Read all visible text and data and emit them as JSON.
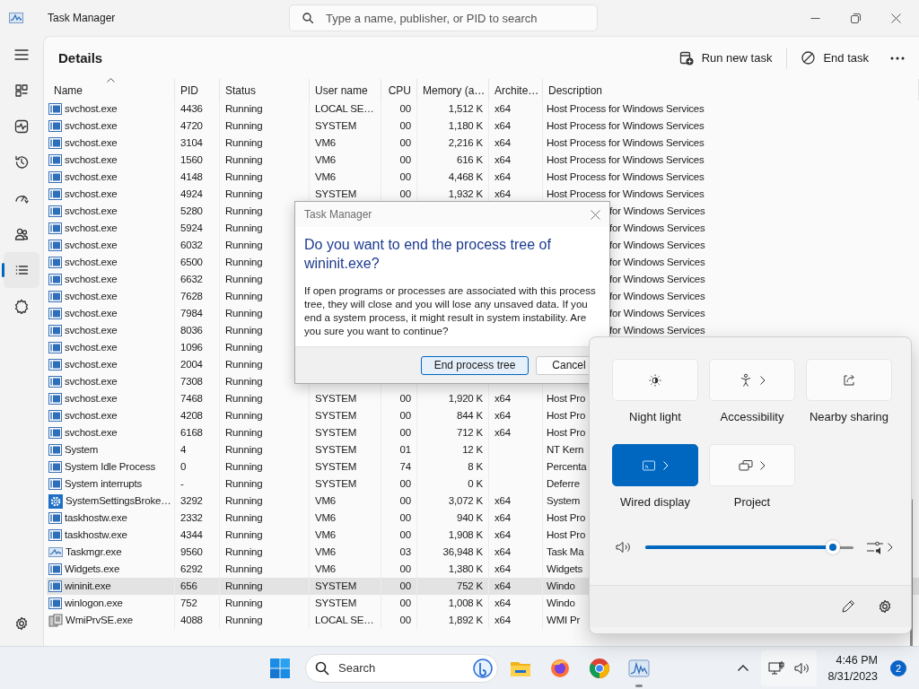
{
  "window": {
    "title": "Task Manager"
  },
  "search": {
    "placeholder": "Type a name, publisher, or PID to search"
  },
  "nav": [
    {
      "kind": "menu",
      "selected": false
    },
    {
      "kind": "processes",
      "selected": false
    },
    {
      "kind": "performance",
      "selected": false
    },
    {
      "kind": "history",
      "selected": false
    },
    {
      "kind": "startup",
      "selected": false
    },
    {
      "kind": "users",
      "selected": false
    },
    {
      "kind": "details",
      "selected": true
    },
    {
      "kind": "services",
      "selected": false
    },
    {
      "kind": "settings",
      "selected": false
    }
  ],
  "page": {
    "title": "Details",
    "actions": [
      {
        "kind": "run",
        "label": "Run new task"
      },
      {
        "kind": "end",
        "label": "End task"
      },
      {
        "kind": "more"
      }
    ]
  },
  "table": {
    "columns": [
      {
        "label": "Name",
        "sorted": true
      },
      {
        "label": "PID",
        "sorted": false
      },
      {
        "label": "Status",
        "sorted": false
      },
      {
        "label": "User name",
        "sorted": false
      },
      {
        "label": "CPU",
        "sorted": false
      },
      {
        "label": "Memory (a…",
        "sorted": false
      },
      {
        "label": "Archite…",
        "sorted": false
      },
      {
        "label": "Description",
        "sorted": false
      }
    ],
    "rows": [
      {
        "kind": "app",
        "name": "svchost.exe",
        "pid": "4436",
        "status": "Running",
        "user": "LOCAL SE…",
        "cpu": "00",
        "memory": "1,512 K",
        "arch": "x64",
        "description": "Host Process for Windows Services",
        "selected": false
      },
      {
        "kind": "app",
        "name": "svchost.exe",
        "pid": "4720",
        "status": "Running",
        "user": "SYSTEM",
        "cpu": "00",
        "memory": "1,180 K",
        "arch": "x64",
        "description": "Host Process for Windows Services",
        "selected": false
      },
      {
        "kind": "app",
        "name": "svchost.exe",
        "pid": "3104",
        "status": "Running",
        "user": "VM6",
        "cpu": "00",
        "memory": "2,216 K",
        "arch": "x64",
        "description": "Host Process for Windows Services",
        "selected": false
      },
      {
        "kind": "app",
        "name": "svchost.exe",
        "pid": "1560",
        "status": "Running",
        "user": "VM6",
        "cpu": "00",
        "memory": "616 K",
        "arch": "x64",
        "description": "Host Process for Windows Services",
        "selected": false
      },
      {
        "kind": "app",
        "name": "svchost.exe",
        "pid": "4148",
        "status": "Running",
        "user": "VM6",
        "cpu": "00",
        "memory": "4,468 K",
        "arch": "x64",
        "description": "Host Process for Windows Services",
        "selected": false
      },
      {
        "kind": "app",
        "name": "svchost.exe",
        "pid": "4924",
        "status": "Running",
        "user": "SYSTEM",
        "cpu": "00",
        "memory": "1,932 K",
        "arch": "x64",
        "description": "Host Process for Windows Services",
        "selected": false
      },
      {
        "kind": "app",
        "name": "svchost.exe",
        "pid": "5280",
        "status": "Running",
        "description": "for Windows Services",
        "selected": false
      },
      {
        "kind": "app",
        "name": "svchost.exe",
        "pid": "5924",
        "status": "Running",
        "description": "for Windows Services",
        "selected": false
      },
      {
        "kind": "app",
        "name": "svchost.exe",
        "pid": "6032",
        "status": "Running",
        "description": "for Windows Services",
        "selected": false
      },
      {
        "kind": "app",
        "name": "svchost.exe",
        "pid": "6500",
        "status": "Running",
        "description": "for Windows Services",
        "selected": false
      },
      {
        "kind": "app",
        "name": "svchost.exe",
        "pid": "6632",
        "status": "Running",
        "description": "for Windows Services",
        "selected": false
      },
      {
        "kind": "app",
        "name": "svchost.exe",
        "pid": "7628",
        "status": "Running",
        "description": "for Windows Services",
        "selected": false
      },
      {
        "kind": "app",
        "name": "svchost.exe",
        "pid": "7984",
        "status": "Running",
        "description": "for Windows Services",
        "selected": false
      },
      {
        "kind": "app",
        "name": "svchost.exe",
        "pid": "8036",
        "status": "Running",
        "description": "for Windows Services",
        "selected": false
      },
      {
        "kind": "app",
        "name": "svchost.exe",
        "pid": "1096",
        "status": "Running",
        "selected": false
      },
      {
        "kind": "app",
        "name": "svchost.exe",
        "pid": "2004",
        "status": "Running",
        "selected": false
      },
      {
        "kind": "app",
        "name": "svchost.exe",
        "pid": "7308",
        "status": "Running",
        "selected": false
      },
      {
        "kind": "app",
        "name": "svchost.exe",
        "pid": "7468",
        "status": "Running",
        "user": "SYSTEM",
        "cpu": "00",
        "memory": "1,920 K",
        "arch": "x64",
        "description": "Host Pro",
        "selected": false
      },
      {
        "kind": "app",
        "name": "svchost.exe",
        "pid": "4208",
        "status": "Running",
        "user": "SYSTEM",
        "cpu": "00",
        "memory": "844 K",
        "arch": "x64",
        "description": "Host Pro",
        "selected": false
      },
      {
        "kind": "app",
        "name": "svchost.exe",
        "pid": "6168",
        "status": "Running",
        "user": "SYSTEM",
        "cpu": "00",
        "memory": "712 K",
        "arch": "x64",
        "description": "Host Pro",
        "selected": false
      },
      {
        "kind": "app",
        "name": "System",
        "pid": "4",
        "status": "Running",
        "user": "SYSTEM",
        "cpu": "01",
        "memory": "12 K",
        "description": "NT Kern",
        "selected": false
      },
      {
        "kind": "app",
        "name": "System Idle Process",
        "pid": "0",
        "status": "Running",
        "user": "SYSTEM",
        "cpu": "74",
        "memory": "8 K",
        "description": "Percenta",
        "selected": false
      },
      {
        "kind": "app",
        "name": "System interrupts",
        "pid": "-",
        "status": "Running",
        "user": "SYSTEM",
        "cpu": "00",
        "memory": "0 K",
        "description": "Deferre",
        "selected": false
      },
      {
        "kind": "gear",
        "name": "SystemSettingsBroke…",
        "pid": "3292",
        "status": "Running",
        "user": "VM6",
        "cpu": "00",
        "memory": "3,072 K",
        "arch": "x64",
        "description": "System",
        "selected": false
      },
      {
        "kind": "app",
        "name": "taskhostw.exe",
        "pid": "2332",
        "status": "Running",
        "user": "VM6",
        "cpu": "00",
        "memory": "940 K",
        "arch": "x64",
        "description": "Host Pro",
        "selected": false
      },
      {
        "kind": "app",
        "name": "taskhostw.exe",
        "pid": "4344",
        "status": "Running",
        "user": "VM6",
        "cpu": "00",
        "memory": "1,908 K",
        "arch": "x64",
        "description": "Host Pro",
        "selected": false
      },
      {
        "kind": "chart",
        "name": "Taskmgr.exe",
        "pid": "9560",
        "status": "Running",
        "user": "VM6",
        "cpu": "03",
        "memory": "36,948 K",
        "arch": "x64",
        "description": "Task Ma",
        "selected": false
      },
      {
        "kind": "app",
        "name": "Widgets.exe",
        "pid": "6292",
        "status": "Running",
        "user": "VM6",
        "cpu": "00",
        "memory": "1,380 K",
        "arch": "x64",
        "description": "Widgets",
        "selected": false
      },
      {
        "kind": "app",
        "name": "wininit.exe",
        "pid": "656",
        "status": "Running",
        "user": "SYSTEM",
        "cpu": "00",
        "memory": "752 K",
        "arch": "x64",
        "description": "Windo",
        "selected": true
      },
      {
        "kind": "app",
        "name": "winlogon.exe",
        "pid": "752",
        "status": "Running",
        "user": "SYSTEM",
        "cpu": "00",
        "memory": "1,008 K",
        "arch": "x64",
        "description": "Windo",
        "selected": false
      },
      {
        "kind": "wmi",
        "name": "WmiPrvSE.exe",
        "pid": "4088",
        "status": "Running",
        "user": "LOCAL SE…",
        "cpu": "00",
        "memory": "1,892 K",
        "arch": "x64",
        "description": "WMI Pr",
        "selected": false
      }
    ]
  },
  "dialog": {
    "title": "Task Manager",
    "heading": "Do you want to end the process tree of wininit.exe?",
    "message": "If open programs or processes are associated with this process tree, they will close and you will lose any unsaved data. If you end a system process, it might result in system instability. Are you sure you want to continue?",
    "buttons": [
      {
        "label": "End process tree",
        "default": true
      },
      {
        "label": "Cancel",
        "default": false
      }
    ]
  },
  "quick_settings": {
    "tiles": [
      {
        "kind": "nightlight",
        "label": "Night light",
        "on": false,
        "chevron": false
      },
      {
        "kind": "accessibility",
        "label": "Accessibility",
        "on": false,
        "chevron": true
      },
      {
        "kind": "share",
        "label": "Nearby sharing",
        "on": false,
        "chevron": false
      },
      {
        "kind": "cast",
        "label": "Wired display",
        "on": true,
        "chevron": true
      },
      {
        "kind": "project",
        "label": "Project",
        "on": false,
        "chevron": true
      }
    ],
    "volume": {
      "level": 0.9
    }
  },
  "taskbar": {
    "search": {
      "placeholder": "Search"
    },
    "apps": [
      {
        "kind": "explorer",
        "active": false
      },
      {
        "kind": "firefox",
        "active": false
      },
      {
        "kind": "chrome",
        "active": false
      },
      {
        "kind": "taskmgr",
        "active": true
      }
    ],
    "time": "4:46 PM",
    "date": "8/31/2023",
    "notifications": "2"
  }
}
